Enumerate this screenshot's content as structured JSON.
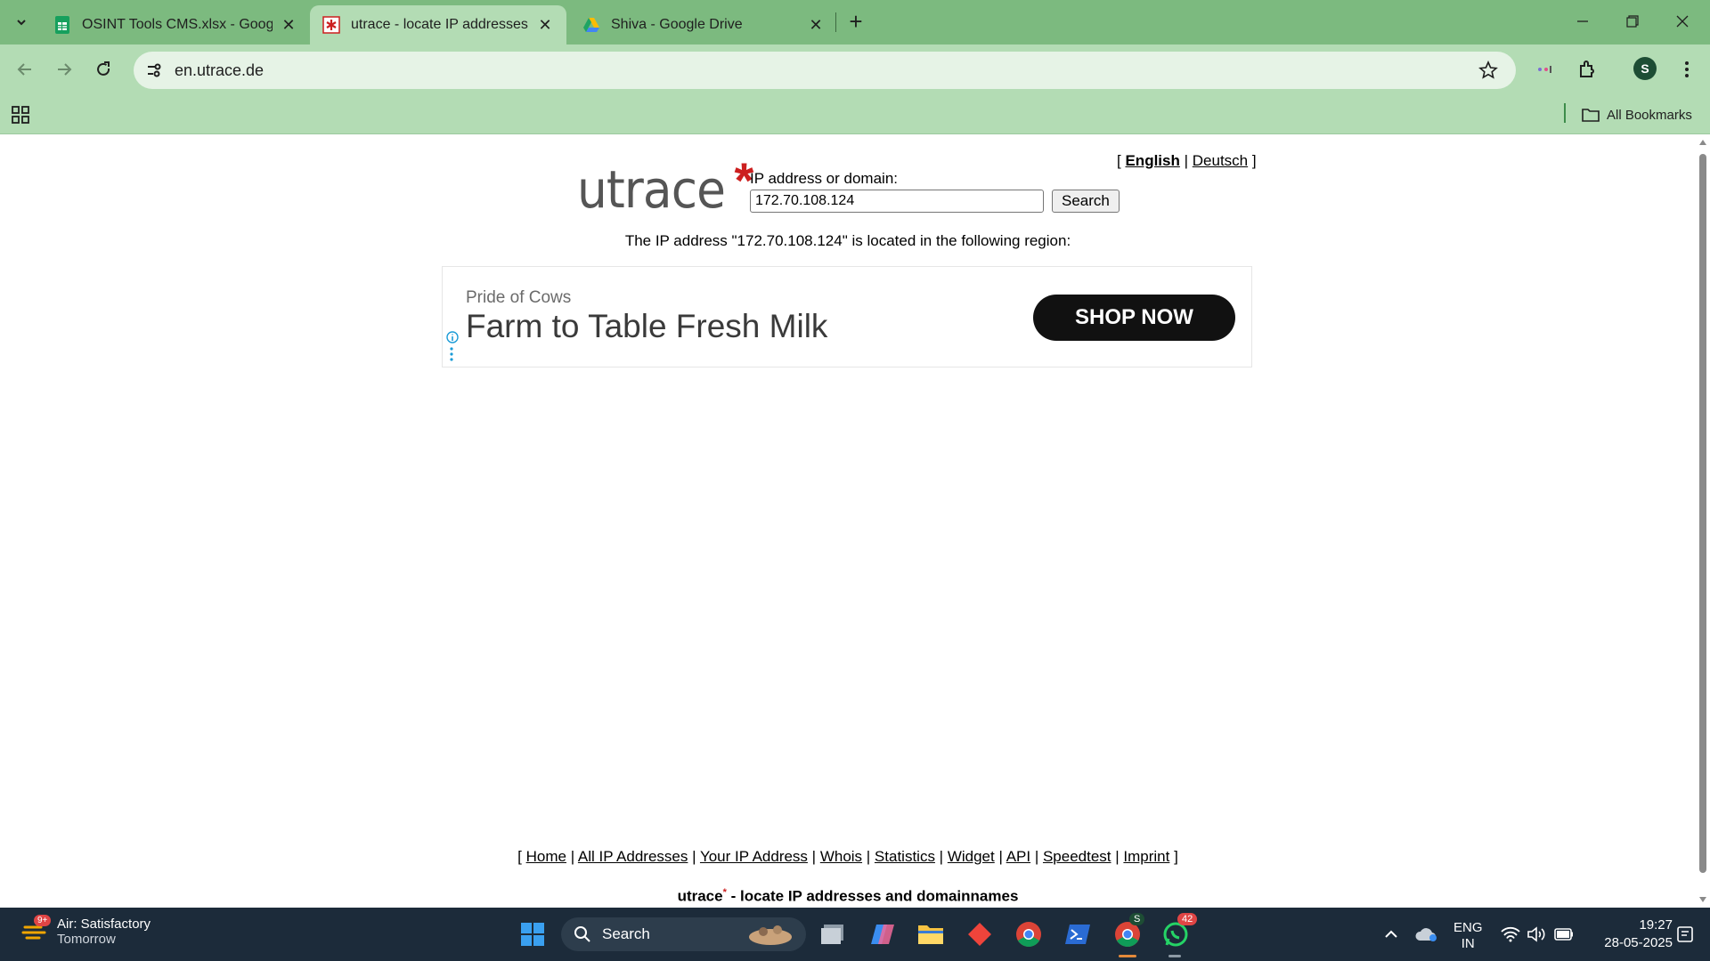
{
  "tabs": [
    {
      "title": "OSINT Tools CMS.xlsx - Google",
      "favicon": "sheets-icon"
    },
    {
      "title": "utrace - locate IP addresses and",
      "favicon": "utrace-favicon-icon",
      "active": true
    },
    {
      "title": "Shiva - Google Drive",
      "favicon": "drive-icon"
    }
  ],
  "address_bar": {
    "url": "en.utrace.de"
  },
  "profile": {
    "initial": "S"
  },
  "bookmarks": {
    "all_label": "All Bookmarks"
  },
  "page": {
    "language": {
      "open": "[",
      "english": "English",
      "sep": "|",
      "deutsch": "Deutsch",
      "close": "]"
    },
    "logo": {
      "word": "utrace",
      "asterisk": "*"
    },
    "search": {
      "label": "IP address or domain:",
      "value": "172.70.108.124",
      "button": "Search"
    },
    "region_text": "The IP address \"172.70.108.124\" is located in the following region:",
    "ad": {
      "brand": "Pride of Cows",
      "headline": "Farm to Table Fresh Milk",
      "cta": "SHOP NOW"
    },
    "footer_links": [
      "Home",
      "All IP Addresses",
      "Your IP Address",
      "Whois",
      "Statistics",
      "Widget",
      "API",
      "Speedtest",
      "Imprint"
    ],
    "tagline_name": "utrace",
    "tagline_asterisk": "*",
    "tagline_rest": " - locate IP addresses and domainnames"
  },
  "taskbar": {
    "weather": {
      "title": "Air: Satisfactory",
      "subtitle": "Tomorrow",
      "badge": "9+"
    },
    "search_label": "Search",
    "whatsapp_badge": "42",
    "chrome_profile_badge": "S",
    "language": {
      "line1": "ENG",
      "line2": "IN"
    },
    "time": "19:27",
    "date": "28-05-2025"
  },
  "colors": {
    "chrome_green": "#7cba7f",
    "toolbar_green": "#b3dcb4",
    "utrace_red": "#cc1f1f",
    "taskbar": "#1c2b3a"
  }
}
